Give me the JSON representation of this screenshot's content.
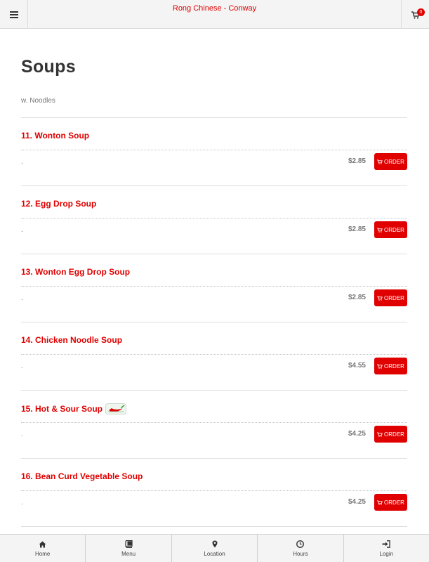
{
  "header": {
    "title": "Rong Chinese - Conway",
    "cart_count": "0"
  },
  "section": {
    "title": "Soups",
    "note": "w. Noodles"
  },
  "items": [
    {
      "name": "11. Wonton Soup",
      "desc": ".",
      "price": "$2.85",
      "button": "ORDER"
    },
    {
      "name": "12. Egg Drop Soup",
      "desc": ".",
      "price": "$2.85",
      "button": "ORDER"
    },
    {
      "name": "13. Wonton Egg Drop Soup",
      "desc": ".",
      "price": "$2.85",
      "button": "ORDER"
    },
    {
      "name": "14. Chicken Noodle Soup",
      "desc": ".",
      "price": "$4.55",
      "button": "ORDER"
    },
    {
      "name": "15. Hot & Sour Soup",
      "desc": ".",
      "price": "$4.25",
      "button": "ORDER",
      "badge": "spicy-pepper-icon"
    },
    {
      "name": "16. Bean Curd Vegetable Soup",
      "desc": ".",
      "price": "$4.25",
      "button": "ORDER"
    }
  ],
  "nav": [
    {
      "label": "Home",
      "icon": "home-icon"
    },
    {
      "label": "Menu",
      "icon": "book-icon"
    },
    {
      "label": "Location",
      "icon": "map-marker-icon"
    },
    {
      "label": "Hours",
      "icon": "clock-icon"
    },
    {
      "label": "Login",
      "icon": "sign-in-icon"
    }
  ],
  "colors": {
    "accent": "#e00000",
    "bar_bg": "#f4f4f4"
  }
}
